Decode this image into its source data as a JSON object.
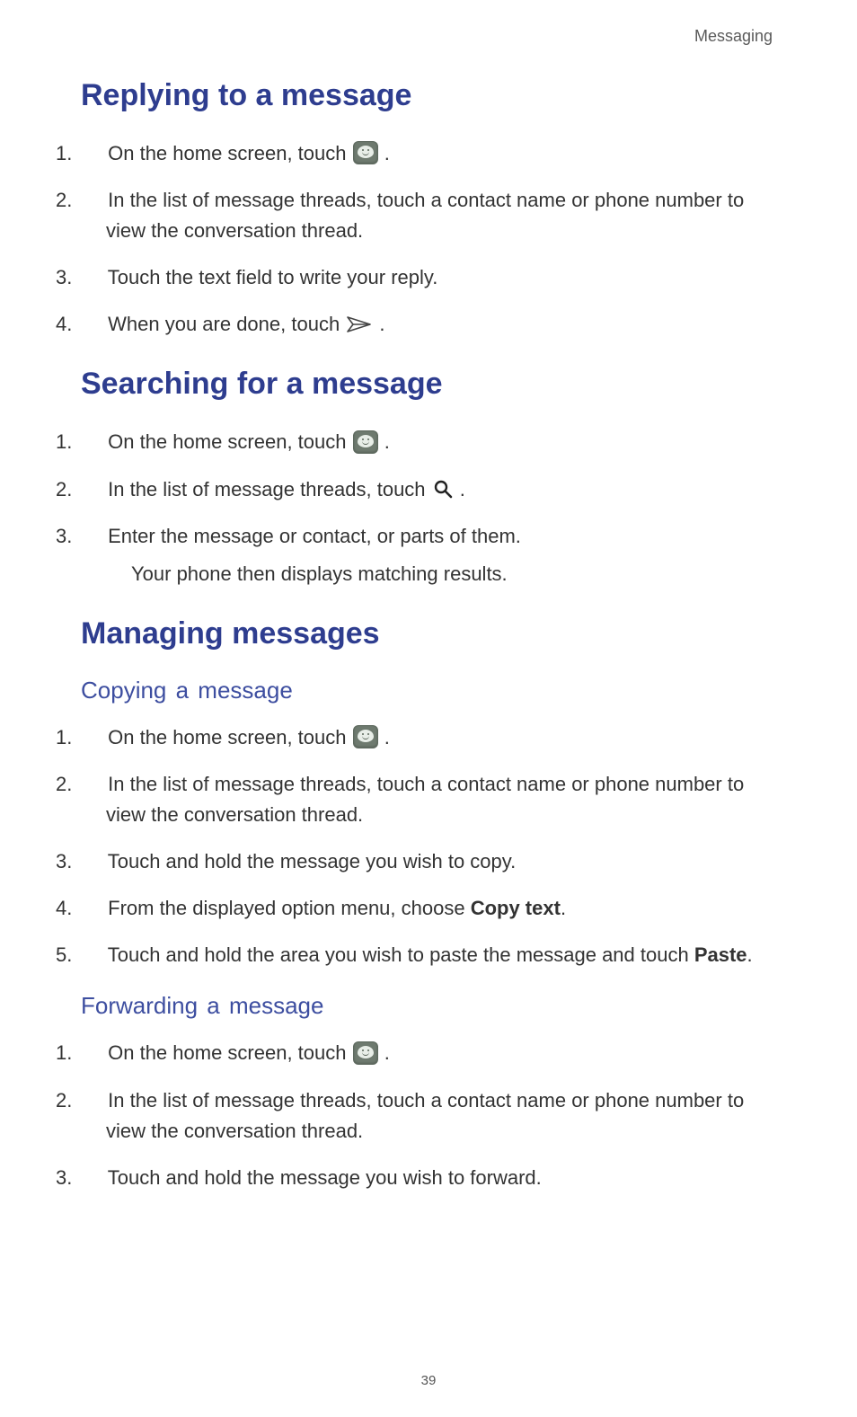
{
  "header": {
    "category": "Messaging"
  },
  "page_number": "39",
  "sections": [
    {
      "id": "replying",
      "title": "Replying to a message",
      "steps": [
        {
          "n": "1.",
          "pre": "On the home screen, touch ",
          "icon": "messaging",
          "post": " ."
        },
        {
          "n": "2.",
          "text": "In the list of message threads, touch a contact name or phone number to view the conversation thread."
        },
        {
          "n": "3.",
          "text": "Touch the text field to write your reply."
        },
        {
          "n": "4.",
          "pre": "When you are done, touch ",
          "icon": "send",
          "post": " ."
        }
      ]
    },
    {
      "id": "searching",
      "title": "Searching for a message",
      "steps": [
        {
          "n": "1.",
          "pre": "On the home screen, touch ",
          "icon": "messaging",
          "post": " ."
        },
        {
          "n": "2.",
          "pre": "In the list of message threads, touch ",
          "icon": "search",
          "post": " ."
        },
        {
          "n": "3.",
          "text": "Enter the message or contact, or parts of them.",
          "cont": "Your phone then displays matching results."
        }
      ]
    },
    {
      "id": "managing",
      "title": "Managing messages",
      "subsections": [
        {
          "id": "copying",
          "title": "Copying  a  message",
          "steps": [
            {
              "n": "1.",
              "pre": "On the home screen, touch ",
              "icon": "messaging",
              "post": " ."
            },
            {
              "n": "2.",
              "text": "In the list of message threads, touch a contact name or phone number to view the conversation thread."
            },
            {
              "n": "3.",
              "text": "Touch and hold the message you wish to copy."
            },
            {
              "n": "4.",
              "richparts": [
                {
                  "t": "From the displayed option menu, choose "
                },
                {
                  "t": "Copy text",
                  "bold": true
                },
                {
                  "t": "."
                }
              ]
            },
            {
              "n": "5.",
              "richparts": [
                {
                  "t": "Touch and hold the area you wish to paste the message and touch "
                },
                {
                  "t": "Paste",
                  "bold": true
                },
                {
                  "t": "."
                }
              ]
            }
          ]
        },
        {
          "id": "forwarding",
          "title": "Forwarding  a  message",
          "steps": [
            {
              "n": "1.",
              "pre": "On the home screen, touch ",
              "icon": "messaging",
              "post": " ."
            },
            {
              "n": "2.",
              "text": "In the list of message threads, touch a contact name or phone number to view the conversation thread."
            },
            {
              "n": "3.",
              "text": "Touch and hold the message you wish to forward."
            }
          ]
        }
      ]
    }
  ]
}
